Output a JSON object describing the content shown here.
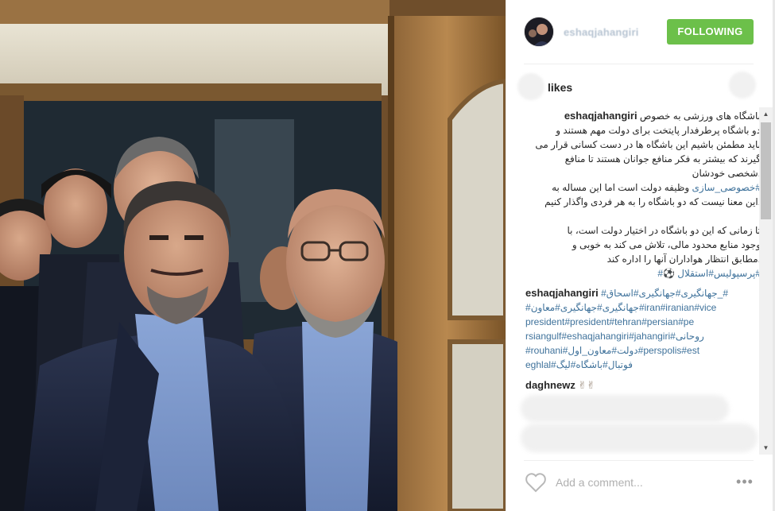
{
  "post": {
    "username": "eshaqjahangiri",
    "follow_label": "FOLLOWING",
    "likes_label": "likes",
    "caption": {
      "user": "eshaqjahangiri",
      "lines": [
        "باشگاه های ورزشی به خصوص",
        "دو باشگاه پرطرفدار پایتخت برای دولت مهم هستند و",
        "باید مطمئن باشیم این باشگاه ها در دست کسانی قرار می",
        "گیرند که بیشتر به فکر منافع جوانان هستند تا منافع",
        ".شخصی خودشان"
      ],
      "tag_line_tag": "#خصوصی_سازی",
      "tag_line_rest": " وظیفه دولت است اما این مساله به",
      "line_after_tag": ".این معنا نیست که دو باشگاه را به هر فردی واگذار کنیم",
      "para2": [
        "تا زمانی که این دو باشگاه در اختیار دولت است، با",
        "وجود منابع محدود مالی، تلاش می کند به خوبی و",
        ".مطابق انتظار هواداران آنها را اداره کند"
      ],
      "tags_end": "#پرسپولیس#استقلال ⚽️#"
    },
    "comment2": {
      "user": "eshaqjahangiri",
      "user_tail": "#جهانگیری#جهانگیری#اسحاق_#",
      "lines": [
        "#جهانگیری#جهانگیری#معاون#iran#iranian#vice",
        "president#president#tehran#persian#pe",
        "rsiangulf#eshaqjahangiri#jahangiri#روحانی",
        "#rouhani#دولت#معاون_اول#perspolis#est",
        "eghlal#فوتبال#باشگاه#لیگ"
      ]
    },
    "comment3": {
      "user": "daghnewz",
      "text": "✌✌"
    },
    "add_comment_placeholder": "Add a comment...",
    "more_label": "•••"
  },
  "colors": {
    "follow_green": "#6cc04a",
    "hashtag_blue": "#3f729b",
    "text": "#262626",
    "placeholder": "#b0b0b0"
  },
  "icons": {
    "like": "heart-icon",
    "options": "more-options-icon",
    "scroll_up": "scroll-up-icon",
    "scroll_down": "scroll-down-icon"
  }
}
